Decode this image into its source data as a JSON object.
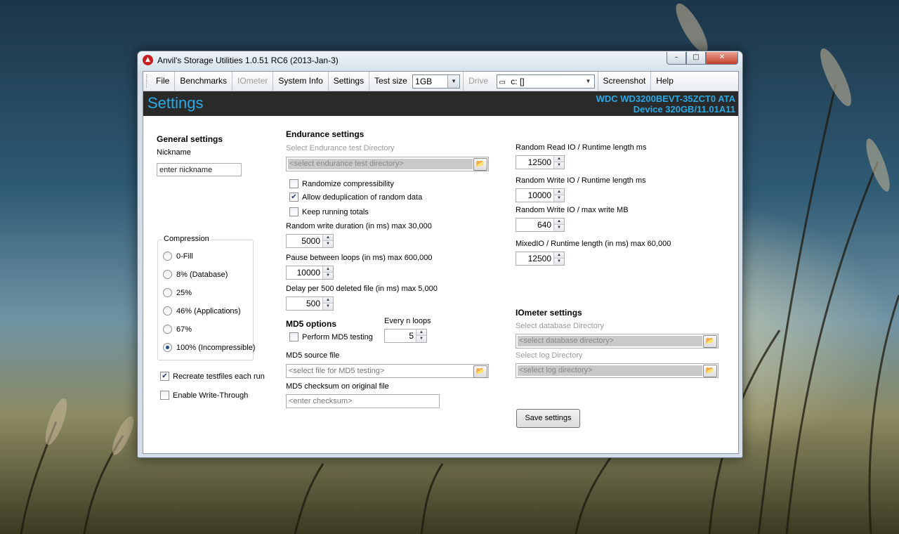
{
  "window": {
    "title": "Anvil's Storage Utilities 1.0.51 RC6 (2013-Jan-3)",
    "app_icon": "anvil-app-icon",
    "controls": {
      "minimize": "minimize-icon",
      "maximize": "maximize-icon",
      "close": "close-icon"
    }
  },
  "toolbar": {
    "file": "File",
    "benchmarks": "Benchmarks",
    "iometer": "IOmeter",
    "system_info": "System Info",
    "settings": "Settings",
    "test_size_label": "Test size",
    "test_size_value": "1GB",
    "drive_label": "Drive",
    "drive_value": "c: []",
    "screenshot": "Screenshot",
    "help": "Help"
  },
  "header": {
    "title": "Settings",
    "drive_model": "WDC WD3200BEVT-35ZCT0 ATA",
    "drive_device": "Device 320GB/11.01A11",
    "accent_color": "#29a9e6"
  },
  "general": {
    "heading": "General settings",
    "nickname_label": "Nickname",
    "nickname_value": "enter nickname",
    "compression_label": "Compression",
    "compression_options": [
      "0-Fill",
      "8% (Database)",
      "25%",
      "46% (Applications)",
      "67%",
      "100% (Incompressible)"
    ],
    "compression_selected": "100% (Incompressible)",
    "recreate_label": "Recreate testfiles each run",
    "recreate_checked": true,
    "write_through_label": "Enable Write-Through",
    "write_through_checked": false
  },
  "endurance": {
    "heading": "Endurance settings",
    "dir_label": "Select Endurance test Directory",
    "dir_placeholder": "<select endurance test directory>",
    "randomize_label": "Randomize compressibility",
    "randomize_checked": false,
    "dedup_label": "Allow deduplication of random data",
    "dedup_checked": true,
    "running_totals_label": "Keep running totals",
    "running_totals_checked": false,
    "random_write_label": "Random write duration (in ms) max 30,000",
    "random_write_value": "5000",
    "pause_label": "Pause between loops (in ms) max 600,000",
    "pause_value": "10000",
    "delay_label": "Delay per 500 deleted file (in ms) max 5,000",
    "delay_value": "500"
  },
  "md5": {
    "heading": "MD5 options",
    "every_n_label": "Every n loops",
    "every_n_value": "5",
    "perform_label": "Perform MD5 testing",
    "perform_checked": false,
    "source_label": "MD5 source file",
    "source_placeholder": "<select file for MD5 testing>",
    "checksum_label": "MD5 checksum on original file",
    "checksum_placeholder": "<enter checksum>"
  },
  "runtime": {
    "rand_read_label": "Random Read IO / Runtime length ms",
    "rand_read_value": "12500",
    "rand_write_label": "Random Write IO / Runtime length ms",
    "rand_write_value": "10000",
    "rand_write_max_label": "Random Write IO / max write MB",
    "rand_write_max_value": "640",
    "mixed_label": "MixedIO / Runtime length (in ms) max 60,000",
    "mixed_value": "12500"
  },
  "iometer": {
    "heading": "IOmeter settings",
    "db_label": "Select database Directory",
    "db_placeholder": "<select database directory>",
    "log_label": "Select log Directory",
    "log_placeholder": "<select log directory>"
  },
  "actions": {
    "save": "Save settings"
  }
}
